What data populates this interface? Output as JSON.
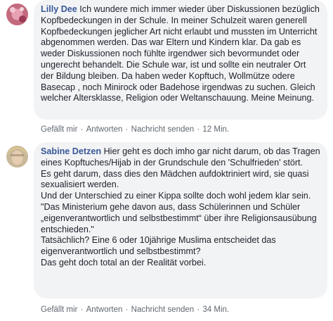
{
  "comments": [
    {
      "author": "Lilly Dee",
      "text": "Ich wundere mich immer wieder über Diskussionen bezüglich Kopfbedeckungen in der Schule. In meiner Schulzeit waren generell Kopfbedeckungen jeglicher Art nicht erlaubt und mussten im Unterricht abgenommen werden. Das war Eltern und Kindern klar. Da gab es weder Diskussionen noch fühlte irgendwer sich bevormundet oder ungerecht behandelt. Die Schule war, ist und sollte ein neutraler Ort der Bildung bleiben. Da haben weder Kopftuch, Wollmütze odere Basecap , noch Minirock oder Badehose irgendwas zu suchen. Gleich welcher Altersklasse, Religion oder Weltanschauung. Meine Meinung.",
      "actions": {
        "like": "Gefällt mir",
        "reply": "Antworten",
        "message": "Nachricht senden",
        "time": "12 Min."
      }
    },
    {
      "author": "Sabine Detzen",
      "text": "Hier geht es doch imho gar nicht darum, ob das Tragen eines Kopftuches/Hijab in der Grundschule den 'Schulfrieden' stört.\nEs geht darum, dass dies den Mädchen aufdoktriniert wird, sie quasi sexualisiert werden.\nUnd der Unterschied zu einer Kippa sollte doch wohl jedem klar sein.\n\"Das Ministerium gehe davon aus, dass Schülerinnen und Schüler „eigenverantwortlich und selbstbestimmt“ über ihre Religionsausübung entschieden.\"\nTatsächlich? Eine 6 oder 10jährige Muslima entscheidet das eigenverantwortlich und selbstbestimmt?\nDas geht doch total an der Realität vorbei.",
      "actions": {
        "like": "Gefällt mir",
        "reply": "Antworten",
        "message": "Nachricht senden",
        "time": "34 Min."
      }
    }
  ],
  "separator": " · ",
  "colors": {
    "author": "#385898",
    "bubble": "#f2f3f5",
    "meta": "#606770",
    "text": "#1d2129"
  }
}
